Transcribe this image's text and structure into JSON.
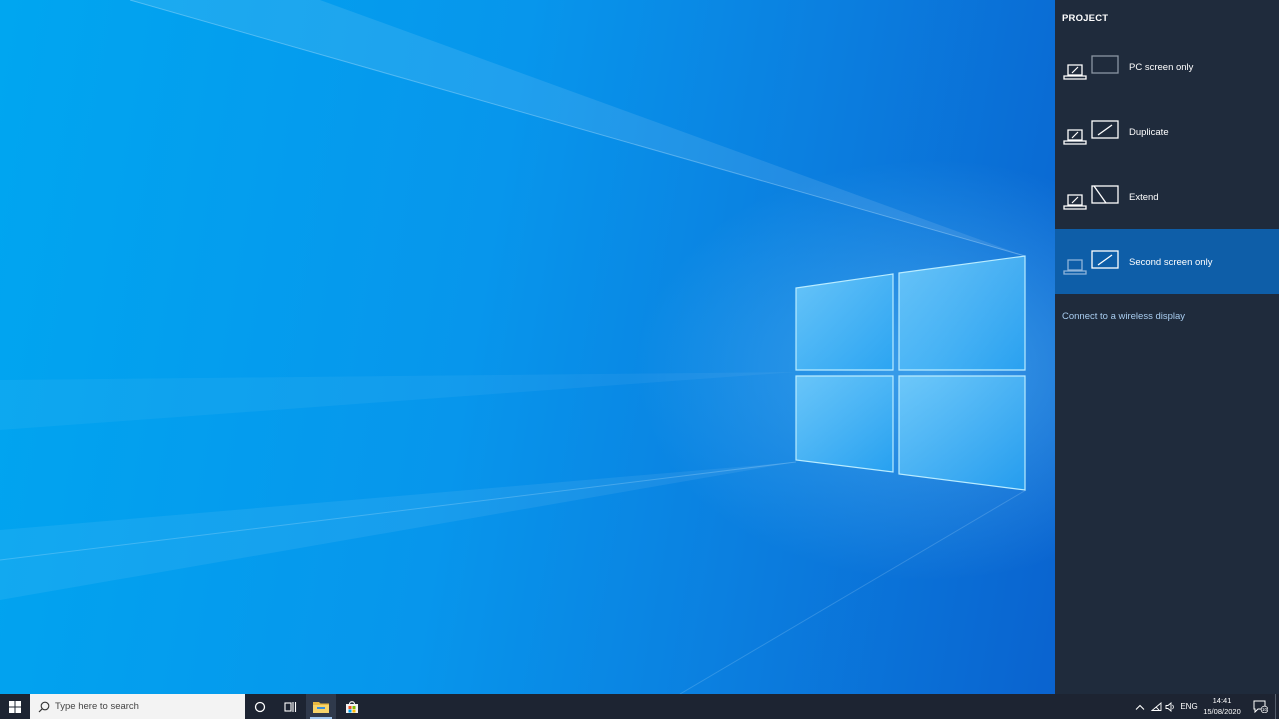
{
  "panel": {
    "title": "PROJECT",
    "modes": [
      {
        "label": "PC screen only",
        "selected": false,
        "icon": "pc-screen-only-icon"
      },
      {
        "label": "Duplicate",
        "selected": false,
        "icon": "duplicate-icon"
      },
      {
        "label": "Extend",
        "selected": false,
        "icon": "extend-icon"
      },
      {
        "label": "Second screen only",
        "selected": true,
        "icon": "second-screen-only-icon"
      }
    ],
    "wireless_link": "Connect to a wireless display"
  },
  "taskbar": {
    "search_placeholder": "Type here to search",
    "apps": [
      "cortana-icon",
      "task-view-icon",
      "file-explorer-icon",
      "microsoft-store-icon"
    ],
    "tray": {
      "language": "ENG",
      "time": "14:41",
      "date": "15/08/2020",
      "notification_count": "10"
    }
  },
  "colors": {
    "panel_bg": "#1f2b3c",
    "selected_bg": "#0e5ea8",
    "taskbar_bg": "#1d2432",
    "link": "#a9cdf0"
  }
}
